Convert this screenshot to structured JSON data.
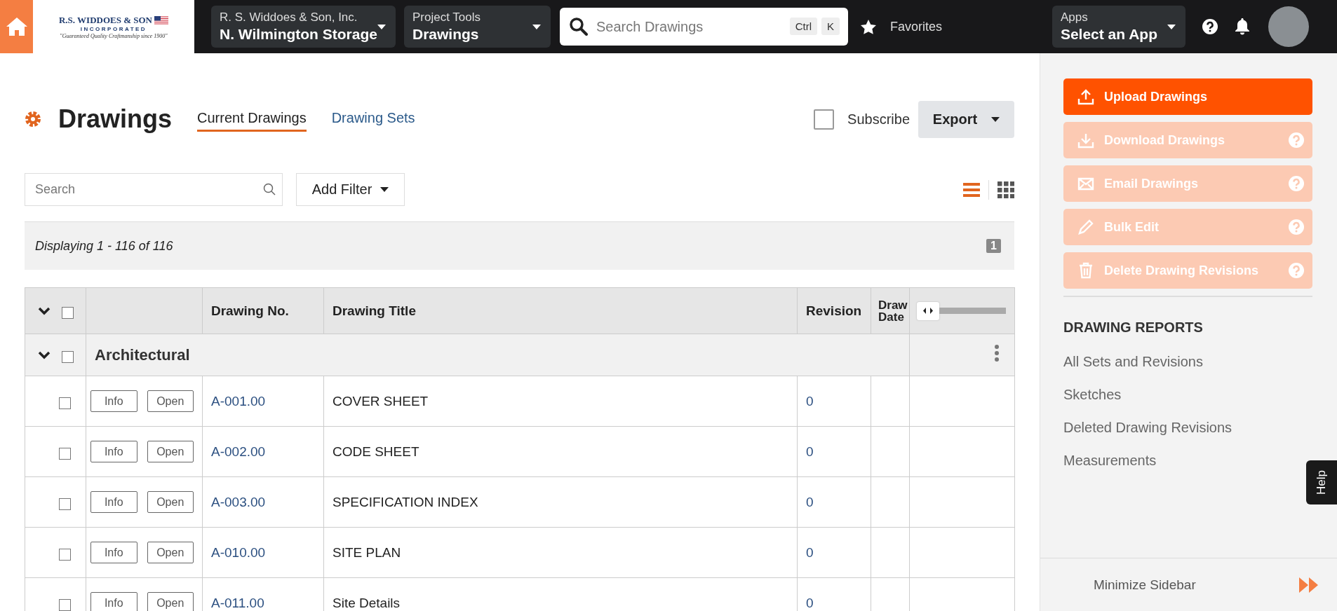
{
  "topbar": {
    "logo": {
      "name": "R.S. WIDDOES & SON",
      "subtitle": "INCORPORATED",
      "tagline": "\"Guaranteed Quality Craftmanship since 1900\""
    },
    "company_selector": {
      "label": "R. S. Widdoes & Son, Inc.",
      "value": "N. Wilmington Storage"
    },
    "tool_selector": {
      "label": "Project Tools",
      "value": "Drawings"
    },
    "search": {
      "placeholder": "Search Drawings",
      "shortcut_keys": [
        "Ctrl",
        "K"
      ]
    },
    "favorites": "Favorites",
    "app_selector": {
      "label": "Apps",
      "value": "Select an App"
    }
  },
  "page": {
    "title": "Drawings",
    "tabs": [
      {
        "label": "Current Drawings",
        "selected": true
      },
      {
        "label": "Drawing Sets",
        "selected": false
      }
    ],
    "subscribe": {
      "label": "Subscribe",
      "checked": false
    },
    "export_button": "Export",
    "search": {
      "placeholder": "Search"
    },
    "add_filter": "Add Filter",
    "view_modes": [
      {
        "kind": "list",
        "selected": true
      },
      {
        "kind": "grid",
        "selected": false
      }
    ],
    "display_summary": "Displaying 1 - 116 of 116",
    "page_number": "1"
  },
  "table": {
    "header_checked": false,
    "columns": [
      "Drawing No.",
      "Drawing Title",
      "Revision",
      "Draw Date"
    ],
    "groups": [
      {
        "name": "Architectural",
        "expanded": true,
        "checked": false,
        "rows": [
          {
            "checked": false,
            "actions": [
              "Info",
              "Open"
            ],
            "number": "A-001.00",
            "title": "COVER SHEET",
            "revision": "0"
          },
          {
            "checked": false,
            "actions": [
              "Info",
              "Open"
            ],
            "number": "A-002.00",
            "title": "CODE SHEET",
            "revision": "0"
          },
          {
            "checked": false,
            "actions": [
              "Info",
              "Open"
            ],
            "number": "A-003.00",
            "title": "SPECIFICATION INDEX",
            "revision": "0"
          },
          {
            "checked": false,
            "actions": [
              "Info",
              "Open"
            ],
            "number": "A-010.00",
            "title": "SITE PLAN",
            "revision": "0"
          },
          {
            "checked": false,
            "actions": [
              "Info",
              "Open"
            ],
            "number": "A-011.00",
            "title": "Site Details",
            "revision": "0"
          }
        ]
      }
    ]
  },
  "sidebar": {
    "actions": [
      {
        "kind": "upload",
        "label": "Upload Drawings",
        "disabled": false,
        "help": false
      },
      {
        "kind": "download",
        "label": "Download Drawings",
        "disabled": true,
        "help": true
      },
      {
        "kind": "email",
        "label": "Email Drawings",
        "disabled": true,
        "help": true
      },
      {
        "kind": "edit",
        "label": "Bulk Edit",
        "disabled": true,
        "help": true
      },
      {
        "kind": "delete",
        "label": "Delete Drawing Revisions",
        "disabled": true,
        "help": true
      }
    ],
    "reports_heading": "DRAWING REPORTS",
    "reports": [
      "All Sets and Revisions",
      "Sketches",
      "Deleted Drawing Revisions",
      "Measurements"
    ],
    "minimize": "Minimize Sidebar",
    "help_tab": "Help"
  }
}
